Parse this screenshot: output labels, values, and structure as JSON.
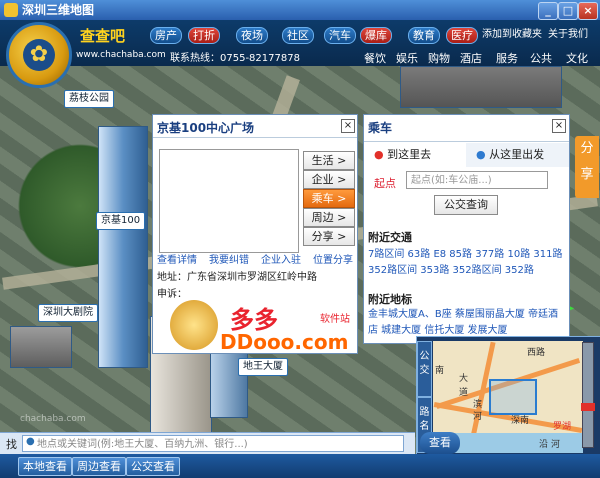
{
  "window": {
    "title": "深圳三维地图",
    "minimize": "_",
    "maximize": "□",
    "close": "×"
  },
  "header": {
    "brand": "查查吧",
    "site": "www.chachaba.com",
    "hotline": "联系热线：0755-82177878",
    "tabs": [
      {
        "label": "房产",
        "red": false
      },
      {
        "label": "打折",
        "red": true
      },
      {
        "label": "夜场",
        "red": false
      },
      {
        "label": "社区",
        "red": false
      },
      {
        "label": "汽车",
        "red": false
      },
      {
        "label": "爆库",
        "red": true
      },
      {
        "label": "教育",
        "red": false
      },
      {
        "label": "医疗",
        "red": true
      }
    ],
    "links": {
      "favorite": "添加到收藏夹",
      "about": "关于我们"
    },
    "categories": [
      "餐饮",
      "娱乐",
      "购物",
      "酒店",
      "服务",
      "公共",
      "文化"
    ]
  },
  "map": {
    "landmarks": [
      "荔枝公园",
      "京基100",
      "深圳大剧院",
      "地王大厦"
    ],
    "watermark": "chachaba.com"
  },
  "popup": {
    "title": "京基100中心广场",
    "close": "×",
    "buttons": [
      {
        "label": "生活 >",
        "active": false
      },
      {
        "label": "企业 >",
        "active": false
      },
      {
        "label": "乘车 >",
        "active": true
      },
      {
        "label": "周边 >",
        "active": false
      },
      {
        "label": "分享 >",
        "active": false
      }
    ],
    "links": [
      "查看详情",
      "我要纠错",
      "企业入驻",
      "位置分享"
    ],
    "address": "地址：广东省深圳市罗湖区红岭中路",
    "comment": "申诉："
  },
  "transit": {
    "title": "乘车",
    "close": "×",
    "tab_to": "到这里去",
    "tab_from": "从这里出发",
    "start_label": "起点",
    "start_placeholder": "起点(如:车公庙...)",
    "search_button": "公交查询",
    "nearby_transit_title": "附近交通",
    "nearby_transit": "7路区间 63路 E8 85路 377路 10路 311路 352路区间 353路 352路区间 352路",
    "nearby_landmarks_title": "附近地标",
    "nearby_landmarks": "金丰城大厦A、B座 蔡屋围丽晶大厦 帝廷酒店 城建大厦 信托大厦 发展大厦"
  },
  "share_tab": "分享",
  "watermark_site": {
    "brand": "多多",
    "sub": "软件站",
    "domain": "DDooo.com"
  },
  "minimap": {
    "side_labels": [
      "公交",
      "路名"
    ],
    "labels": [
      "西路",
      "南",
      "大",
      "道",
      "滨",
      "河",
      "深南",
      "罗湖",
      "沿",
      "河"
    ],
    "search_button": "查看"
  },
  "search": {
    "label": "找",
    "placeholder": "地点或关键词(例:地王大厦、百纳九洲、银行...)"
  },
  "bottom_buttons": [
    "本地查看",
    "周边查看",
    "公交查看"
  ]
}
